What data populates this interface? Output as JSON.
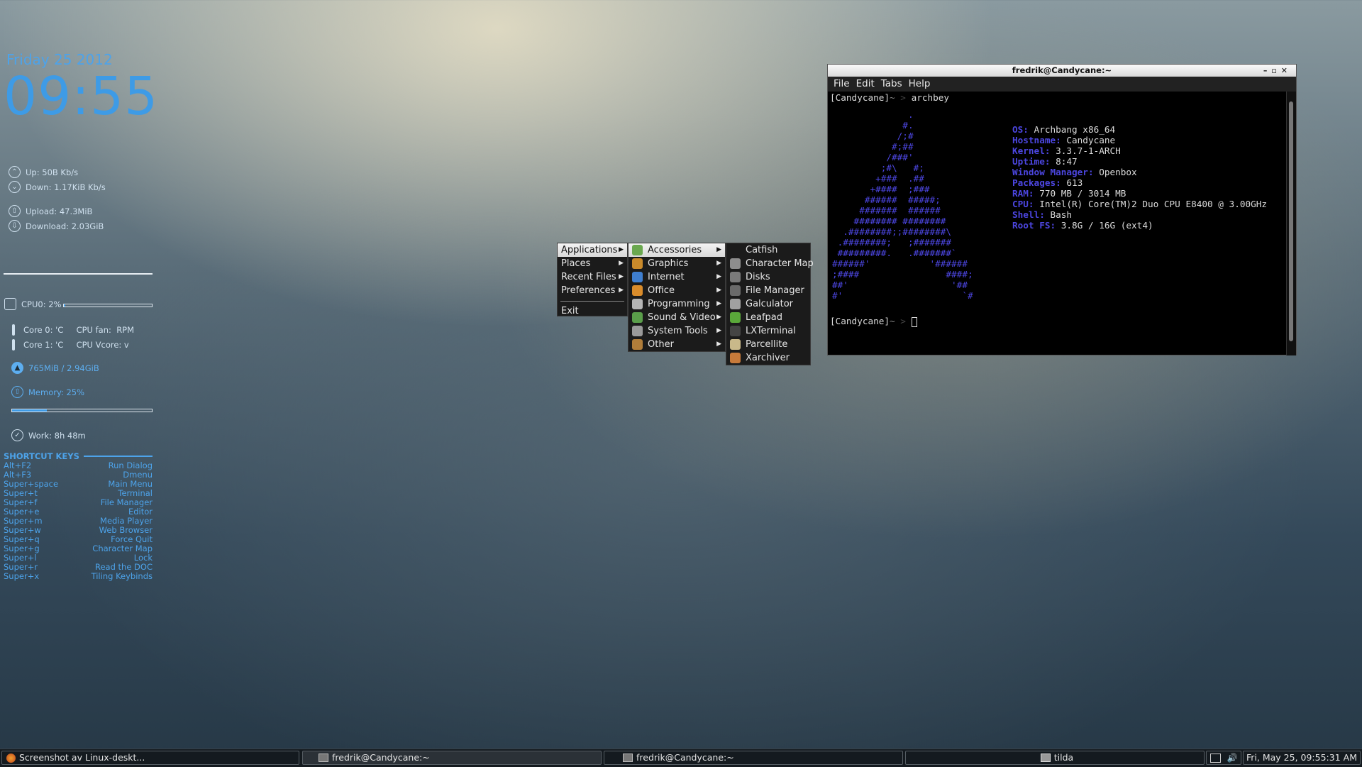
{
  "conky": {
    "date": "Friday 25 2012",
    "time": "09:55",
    "up": "Up: 50B   Kb/s",
    "down": "Down: 1.17KiB Kb/s",
    "upload": "Upload: 47.3MiB",
    "download": "Download: 2.03GiB",
    "cpu0": "CPU0: 2%",
    "cpu0_percent": 2,
    "core0": "Core 0: 'C     CPU fan:  RPM",
    "core1": "Core 1: 'C     CPU Vcore: v",
    "mem_used": "765MiB / 2.94GiB",
    "memory": "Memory: 25%",
    "memory_percent": 25,
    "work": "Work:  8h 48m"
  },
  "shortcuts": {
    "title": "SHORTCUT KEYS",
    "items": [
      {
        "key": "Alt+F2",
        "action": "Run Dialog"
      },
      {
        "key": "Alt+F3",
        "action": "Dmenu"
      },
      {
        "key": "Super+space",
        "action": "Main Menu"
      },
      {
        "key": "Super+t",
        "action": "Terminal"
      },
      {
        "key": "Super+f",
        "action": "File Manager"
      },
      {
        "key": "Super+e",
        "action": "Editor"
      },
      {
        "key": "Super+m",
        "action": "Media Player"
      },
      {
        "key": "Super+w",
        "action": "Web Browser"
      },
      {
        "key": "Super+q",
        "action": "Force Quit"
      },
      {
        "key": "Super+g",
        "action": "Character Map"
      },
      {
        "key": "Super+l",
        "action": "Lock"
      },
      {
        "key": "Super+r",
        "action": "Read the DOC"
      },
      {
        "key": "Super+x",
        "action": "Tiling Keybinds"
      }
    ]
  },
  "root_menu": {
    "items": [
      "Applications",
      "Places",
      "Recent Files",
      "Preferences"
    ],
    "exit": "Exit"
  },
  "apps_menu": {
    "items": [
      {
        "label": "Accessories",
        "icon": "accessories-icon",
        "color": "#6aa84f"
      },
      {
        "label": "Graphics",
        "icon": "graphics-icon",
        "color": "#c98a2b"
      },
      {
        "label": "Internet",
        "icon": "internet-icon",
        "color": "#3f7fd0"
      },
      {
        "label": "Office",
        "icon": "office-icon",
        "color": "#d98c2b"
      },
      {
        "label": "Programming",
        "icon": "programming-icon",
        "color": "#b5b5b5"
      },
      {
        "label": "Sound & Video",
        "icon": "sound-video-icon",
        "color": "#5a9e4a"
      },
      {
        "label": "System Tools",
        "icon": "system-tools-icon",
        "color": "#9a9a9a"
      },
      {
        "label": "Other",
        "icon": "other-icon",
        "color": "#b07d3a"
      }
    ]
  },
  "accessories_menu": {
    "items": [
      {
        "label": "Catfish",
        "icon": "",
        "color": ""
      },
      {
        "label": "Character Map",
        "icon": "character-map-icon",
        "color": "#8d8d8d"
      },
      {
        "label": "Disks",
        "icon": "disks-icon",
        "color": "#7a7a7a"
      },
      {
        "label": "File Manager",
        "icon": "file-manager-icon",
        "color": "#6a6a6a"
      },
      {
        "label": "Galculator",
        "icon": "galculator-icon",
        "color": "#a0a0a0"
      },
      {
        "label": "Leafpad",
        "icon": "leafpad-icon",
        "color": "#5aa83a"
      },
      {
        "label": "LXTerminal",
        "icon": "lxterminal-icon",
        "color": "#444444"
      },
      {
        "label": "Parcellite",
        "icon": "parcellite-icon",
        "color": "#c9b98a"
      },
      {
        "label": "Xarchiver",
        "icon": "xarchiver-icon",
        "color": "#c87a3a"
      }
    ]
  },
  "terminal": {
    "title": "fredrik@Candycane:~",
    "menu": [
      "File",
      "Edit",
      "Tabs",
      "Help"
    ],
    "prompt_host": "[Candycane]",
    "prompt_dir": "~",
    "command": "archbey",
    "art": "              .\n             #.\n            /;#\n           #;##\n          /###'\n         ;#\\   #;\n        +###  .##\n       +####  ;###\n      ######  #####;\n     #######  ######\n    ######## ########\n  .########;;########\\\n .########;   ;#######\n #########.   .#######`\n######'           '######\n;####                ####;\n##'                   '##\n#'                      `#",
    "sysinfo": [
      {
        "k": "OS:",
        "v": " Archbang x86_64"
      },
      {
        "k": "Hostname:",
        "v": " Candycane"
      },
      {
        "k": "Kernel:",
        "v": " 3.3.7-1-ARCH"
      },
      {
        "k": "Uptime:",
        "v": " 8:47"
      },
      {
        "k": "Window Manager:",
        "v": " Openbox"
      },
      {
        "k": "Packages:",
        "v": " 613"
      },
      {
        "k": "RAM:",
        "v": " 770 MB / 3014 MB"
      },
      {
        "k": "CPU:",
        "v": " Intel(R) Core(TM)2 Duo CPU E8400 @ 3.00GHz"
      },
      {
        "k": "Shell:",
        "v": " Bash"
      },
      {
        "k": "Root FS:",
        "v": " 3.8G / 16G (ext4)"
      }
    ]
  },
  "taskbar": {
    "tasks": [
      {
        "label": "Screenshot av Linux-deskt...",
        "icon": "firefox-icon"
      },
      {
        "label": "fredrik@Candycane:~",
        "icon": "terminal-icon"
      },
      {
        "label": "fredrik@Candycane:~",
        "icon": "terminal-icon"
      },
      {
        "label": "tilda",
        "icon": "tilda-icon"
      }
    ],
    "clock": "Fri, May 25, 09:55:31 AM"
  }
}
